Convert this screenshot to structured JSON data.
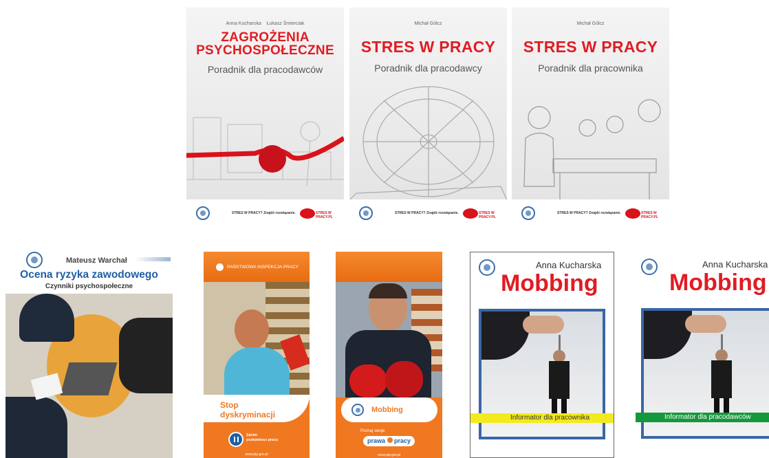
{
  "top_row": [
    {
      "authors": [
        "Anna Kucharska",
        "Łukasz Śmierciak"
      ],
      "title_lines": [
        "ZAGROŻENIA",
        "PSYCHOSPOŁECZNE"
      ],
      "subtitle": "Poradnik dla pracodawców",
      "footer_text": "STRES W PRACY? Znajdź rozwiązanie.",
      "badge": "STRES W PRACY.PL"
    },
    {
      "authors": [
        "Michał Gólcz"
      ],
      "title_lines": [
        "STRES W PRACY"
      ],
      "subtitle": "Poradnik dla pracodawcy",
      "footer_text": "STRES W PRACY? Znajdź rozwiązanie.",
      "badge": "STRES W PRACY.PL"
    },
    {
      "authors": [
        "Michał Gólcz"
      ],
      "title_lines": [
        "STRES W PRACY"
      ],
      "subtitle": "Poradnik dla pracownika",
      "footer_text": "STRES W PRACY? Znajdź rozwiązanie.",
      "badge": "STRES W PRACY.PL"
    }
  ],
  "ocena": {
    "author": "Mateusz Warchał",
    "title": "Ocena ryzyka zawodowego",
    "subtitle": "Czynniki psychospołeczne"
  },
  "stop": {
    "header": "PAŃSTWOWA INSPEKCJA PRACY",
    "title_lines": [
      "Stop",
      "dyskryminacji"
    ],
    "note_lines": [
      "Zanim",
      "podejmiesz pracę"
    ],
    "url": "www.pip.gov.pl"
  },
  "mobbing_leaflet": {
    "title": "Mobbing",
    "tag_small": "Poznaj swoje",
    "tag_big_1": "prawa",
    "tag_big_2": "pracy",
    "url": "www.pip.gov.pl"
  },
  "mobbing_books": [
    {
      "author": "Anna Kucharska",
      "title": "Mobbing",
      "band": "Informator dla pracownika",
      "band_color": "#f2ea1d"
    },
    {
      "author": "Anna Kucharska",
      "title": "Mobbing",
      "band": "Informator dla pracodawców",
      "band_color": "#15983b"
    }
  ],
  "colors": {
    "red": "#e01c24",
    "blue": "#1f5fa5",
    "orange": "#f07820"
  }
}
